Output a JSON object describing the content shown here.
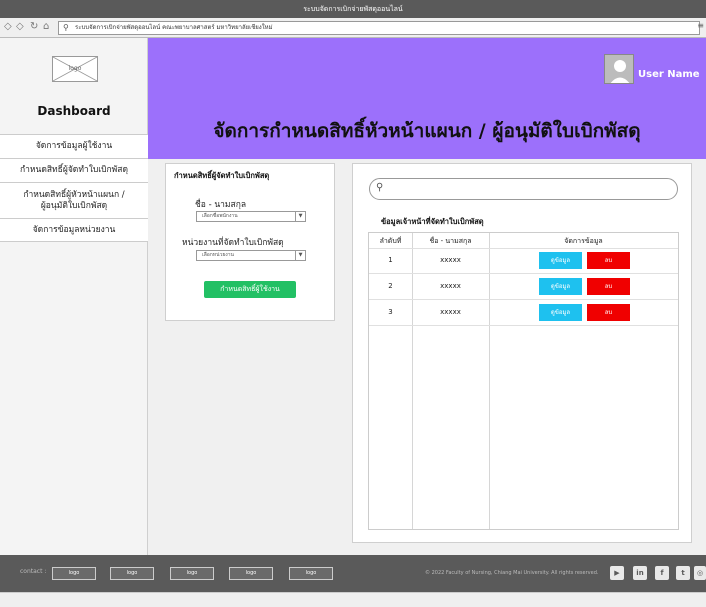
{
  "browser": {
    "window_title": "ระบบจัดการเบิกจ่ายพัสดุออนไลน์",
    "url": "ระบบจัดการเบิกจ่ายพัสดุออนไลน์ คณะพยาบาลศาสตร์ มหาวิทยาลัยเชียงใหม่"
  },
  "sidebar": {
    "logo_text": "logo",
    "title": "Dashboard",
    "items": [
      {
        "label": "จัดการข้อมูลผู้ใช้งาน"
      },
      {
        "label": "กำหนดสิทธิ์ผู้จัดทำใบเบิกพัสดุ"
      },
      {
        "label": "กำหนดสิทธิ์ผู้หัวหน้าแผนก / ผู้อนุมัติใบเบิกพัสดุ"
      },
      {
        "label": "จัดการข้อมูลหน่วยงาน"
      }
    ]
  },
  "header": {
    "username": "User Name",
    "page_title": "จัดการกำหนดสิทธิ์หัวหน้าแผนก / ผู้อนุมัติใบเบิกพัสดุ"
  },
  "form": {
    "title": "กำหนดสิทธิ์ผู้จัดทำใบเบิกพัสดุ",
    "name_label": "ชื่อ - นามสกุล",
    "name_select": "เลือกชื่อพนักงาน",
    "dept_label": "หน่วยงานที่จัดทำใบเบิกพัสดุ",
    "dept_select": "เลือกหน่วยงาน",
    "submit_label": "กำหนดสิทธิ์ผู้ใช้งาน"
  },
  "list": {
    "search_placeholder": "",
    "title": "ข้อมูลเจ้าหน้าที่จัดทำใบเบิกพัสดุ",
    "columns": [
      "ลำดับที่",
      "ชื่อ - นามสกุล",
      "จัดการข้อมูล"
    ],
    "rows": [
      {
        "no": "1",
        "name": "xxxxx",
        "view": "ดูข้อมูล",
        "delete": "ลบ"
      },
      {
        "no": "2",
        "name": "xxxxx",
        "view": "ดูข้อมูล",
        "delete": "ลบ"
      },
      {
        "no": "3",
        "name": "xxxxx",
        "view": "ดูข้อมูล",
        "delete": "ลบ"
      }
    ]
  },
  "footer": {
    "contact": "contact :",
    "logos": [
      "logo",
      "logo",
      "logo",
      "logo",
      "logo"
    ],
    "copyright": "© 2022 Faculty of Nursing, Chiang Mai University. All rights reserved.",
    "social": [
      "youtube-icon",
      "linkedin-icon",
      "facebook-icon",
      "twitter-icon",
      "instagram-icon"
    ]
  },
  "colors": {
    "header": "#9c70fb",
    "primary_button": "#22c064",
    "view_button": "#1ec1ef",
    "delete_button": "#f00000",
    "footer": "#5a5a5a"
  }
}
